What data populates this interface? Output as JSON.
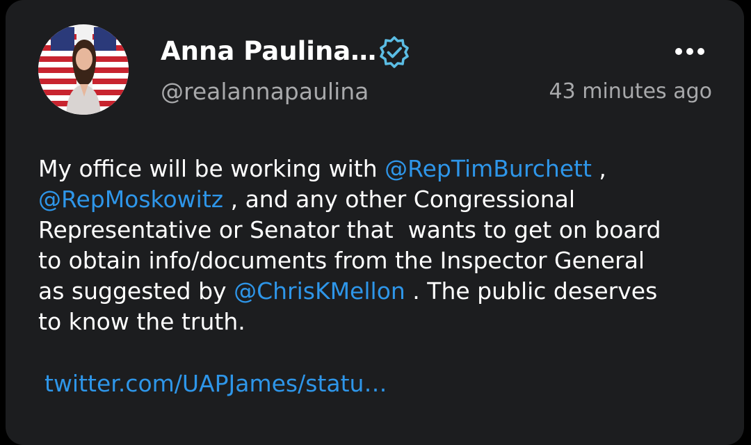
{
  "profile": {
    "display_name": "Anna Paulina…",
    "handle": "@realannapaulina",
    "verified": true,
    "timestamp": "43 minutes ago"
  },
  "icons": {
    "verified": "verified-badge-icon",
    "more": "more-options-icon"
  },
  "colors": {
    "background": "#000000",
    "card": "#1c1d1f",
    "link": "#2e96e9",
    "secondary_text": "#a8a9ab",
    "verified": "#5bbde4"
  },
  "tweet": {
    "seg1": "My office will be working with ",
    "mention1": "@RepTimBurchett",
    "seg2": " ,\n",
    "mention2": "@RepMoskowitz",
    "seg3": " , and any other Congressional\nRepresentative or Senator that  wants to get on board\nto obtain info/documents from the Inspector General\nas suggested by ",
    "mention3": "@ChrisKMellon",
    "seg4": " . The public deserves\nto know the truth.",
    "link": "twitter.com/UAPJames/statu…"
  }
}
